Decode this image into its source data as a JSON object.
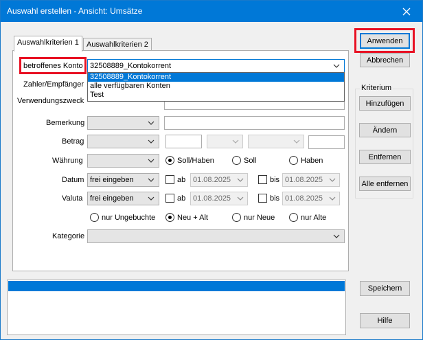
{
  "window": {
    "title": "Auswahl erstellen - Ansicht: Umsätze"
  },
  "tabs": [
    {
      "label": "Auswahlkriterien 1",
      "active": true
    },
    {
      "label": "Auswahlkriterien 2",
      "active": false
    }
  ],
  "fields": {
    "konto": {
      "label": "betroffenes Konto",
      "value": "32508889_Kontokorrent"
    },
    "zahler": {
      "label": "Zahler/Empfänger"
    },
    "verwendungszweck": {
      "label": "Verwendungszweck"
    },
    "bemerkung": {
      "label": "Bemerkung"
    },
    "betrag": {
      "label": "Betrag"
    },
    "waehrung": {
      "label": "Währung"
    },
    "datum": {
      "label": "Datum",
      "mode": "frei eingeben",
      "ab_label": "ab",
      "ab_value": "01.08.2025",
      "bis_label": "bis",
      "bis_value": "01.08.2025"
    },
    "valuta": {
      "label": "Valuta",
      "mode": "frei eingeben",
      "ab_label": "ab",
      "ab_value": "01.08.2025",
      "bis_label": "bis",
      "bis_value": "01.08.2025"
    },
    "kategorie": {
      "label": "Kategorie"
    }
  },
  "konto_options": [
    "32508889_Kontokorrent",
    "alle verfügbaren Konten",
    "Test"
  ],
  "soll_haben": {
    "options": [
      "Soll/Haben",
      "Soll",
      "Haben"
    ],
    "selected": "Soll/Haben"
  },
  "buchungen": {
    "options": [
      "nur Ungebuchte",
      "Neu + Alt",
      "nur Neue",
      "nur Alte"
    ],
    "selected": "Neu + Alt"
  },
  "buttons": {
    "anwenden": "Anwenden",
    "abbrechen": "Abbrechen",
    "hinzufuegen": "Hinzufügen",
    "aendern": "Ändern",
    "entfernen": "Entfernen",
    "alle_entfernen": "Alle entfernen",
    "speichern": "Speichern",
    "hilfe": "Hilfe"
  },
  "kriterium": {
    "title": "Kriterium"
  },
  "colors": {
    "accent": "#0078d7",
    "highlight": "#e81123"
  }
}
